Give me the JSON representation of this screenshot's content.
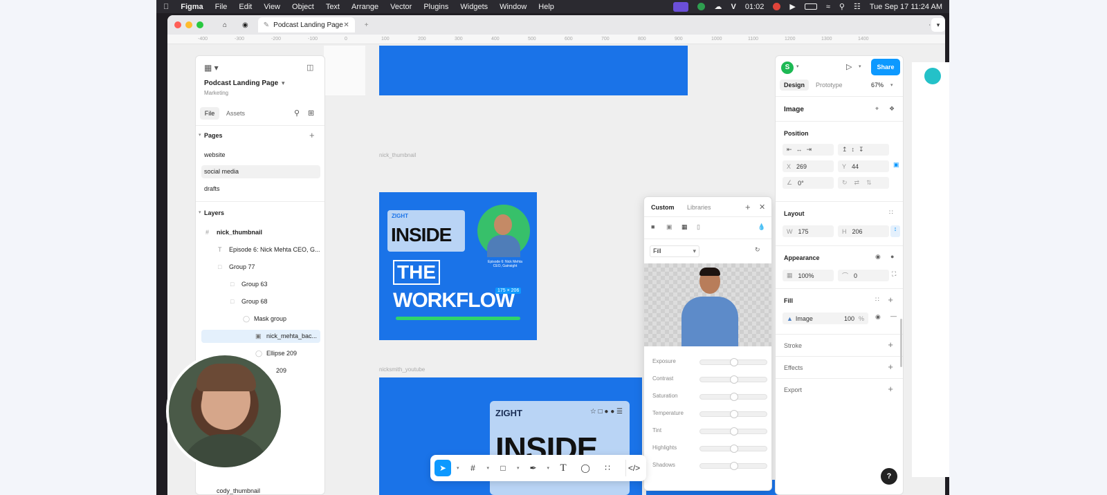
{
  "menubar": {
    "app": "Figma",
    "items": [
      "File",
      "Edit",
      "View",
      "Object",
      "Text",
      "Arrange",
      "Vector",
      "Plugins",
      "Widgets",
      "Window",
      "Help"
    ],
    "timer": "01:02",
    "datetime": "Tue Sep 17  11:24 AM"
  },
  "window": {
    "tab_title": "Podcast Landing Page"
  },
  "ruler": [
    "-400",
    "-300",
    "-200",
    "-100",
    "0",
    "100",
    "200",
    "300",
    "400",
    "500",
    "600",
    "700",
    "800",
    "900",
    "1000",
    "1100",
    "1200",
    "1300",
    "1400"
  ],
  "left_panel": {
    "file_name": "Podcast Landing Page",
    "team": "Marketing",
    "tabs": [
      "File",
      "Assets"
    ],
    "pages_label": "Pages",
    "pages": [
      "website",
      "social media",
      "drafts"
    ],
    "layers_label": "Layers",
    "layers": [
      {
        "name": "nick_thumbnail",
        "indent": 0,
        "bold": true
      },
      {
        "name": "Episode 6: Nick Mehta CEO, G...",
        "indent": 1
      },
      {
        "name": "Group 77",
        "indent": 1
      },
      {
        "name": "Group 63",
        "indent": 2
      },
      {
        "name": "Group 68",
        "indent": 2
      },
      {
        "name": "Mask group",
        "indent": 3
      },
      {
        "name": "nick_mehta_bac...",
        "indent": 4,
        "selected": true
      },
      {
        "name": "Ellipse 209",
        "indent": 4
      },
      {
        "name": "209",
        "indent": 4
      }
    ],
    "bottom_layer": "cody_thumbnail"
  },
  "canvas": {
    "frame_label_1": "nick_thumbnail",
    "frame_label_2": "nicksmith_youtube",
    "thumb_brand": "ZIGHT",
    "thumb_line1": "INSIDE",
    "thumb_line2": "THE",
    "thumb_line3": "WORKFLOW",
    "thumb_caption": "Episode 6: Nick Mehta CEO, Gainsight",
    "dimension_badge": "175 × 206",
    "yt_brand": "ZIGHT",
    "yt_title": "INSIDE"
  },
  "picker": {
    "tabs": [
      "Custom",
      "Libraries"
    ],
    "fill_mode": "Fill",
    "sliders": [
      {
        "label": "Exposure",
        "value": 0.5
      },
      {
        "label": "Contrast",
        "value": 0.5
      },
      {
        "label": "Saturation",
        "value": 0.5
      },
      {
        "label": "Temperature",
        "value": 0.5
      },
      {
        "label": "Tint",
        "value": 0.5
      },
      {
        "label": "Highlights",
        "value": 0.5
      },
      {
        "label": "Shadows",
        "value": 0.5
      }
    ]
  },
  "design_panel": {
    "avatar_letter": "S",
    "share": "Share",
    "tabs": [
      "Design",
      "Prototype"
    ],
    "zoom": "67%",
    "selection_type": "Image",
    "position_label": "Position",
    "x_label": "X",
    "x": "269",
    "y_label": "Y",
    "y": "44",
    "rotation": "0°",
    "layout_label": "Layout",
    "w_label": "W",
    "w": "175",
    "h_label": "H",
    "h": "206",
    "appearance_label": "Appearance",
    "opacity": "100%",
    "radius": "0",
    "fill_label": "Fill",
    "fill_type": "Image",
    "fill_opacity": "100",
    "fill_pct": "%",
    "stroke_label": "Stroke",
    "effects_label": "Effects",
    "export_label": "Export",
    "help": "?"
  },
  "colors": {
    "accent": "#0d99ff",
    "thumb_blue": "#1a73e8",
    "avatar_green": "#1db954"
  }
}
